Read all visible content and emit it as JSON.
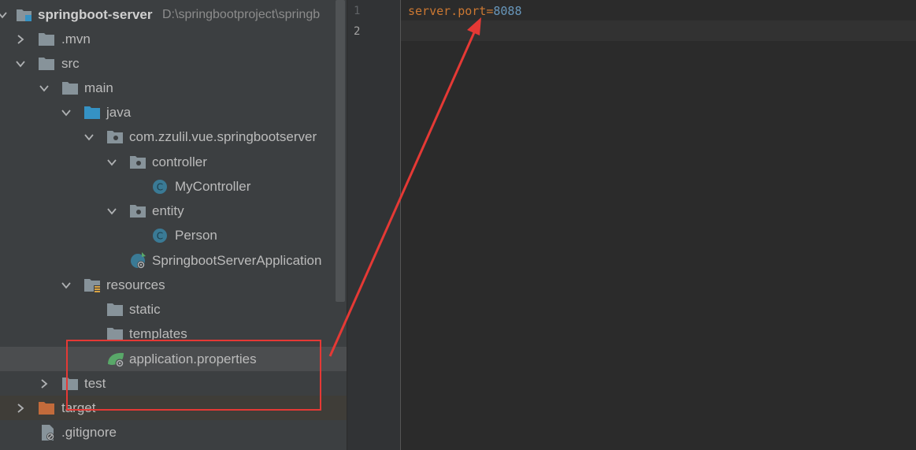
{
  "project_tree": {
    "root": {
      "label": "springboot-server",
      "path": "D:\\springbootproject\\springb"
    },
    "items": [
      {
        "label": ".mvn"
      },
      {
        "label": "src"
      },
      {
        "label": "main"
      },
      {
        "label": "java"
      },
      {
        "label": "com.zzulil.vue.springbootserver"
      },
      {
        "label": "controller"
      },
      {
        "label": "MyController"
      },
      {
        "label": "entity"
      },
      {
        "label": "Person"
      },
      {
        "label": "SpringbootServerApplication"
      },
      {
        "label": "resources"
      },
      {
        "label": "static"
      },
      {
        "label": "templates"
      },
      {
        "label": "application.properties"
      },
      {
        "label": "test"
      },
      {
        "label": "target"
      },
      {
        "label": ".gitignore"
      }
    ]
  },
  "editor": {
    "line_numbers": [
      "1",
      "2"
    ],
    "lines": [
      {
        "key": "server.port",
        "eq": "=",
        "value": "8088"
      },
      {
        "text": ""
      }
    ]
  },
  "colors": {
    "annotation_red": "#e53935",
    "panel_bg": "#3c3f41",
    "editor_bg": "#2b2b2b"
  }
}
